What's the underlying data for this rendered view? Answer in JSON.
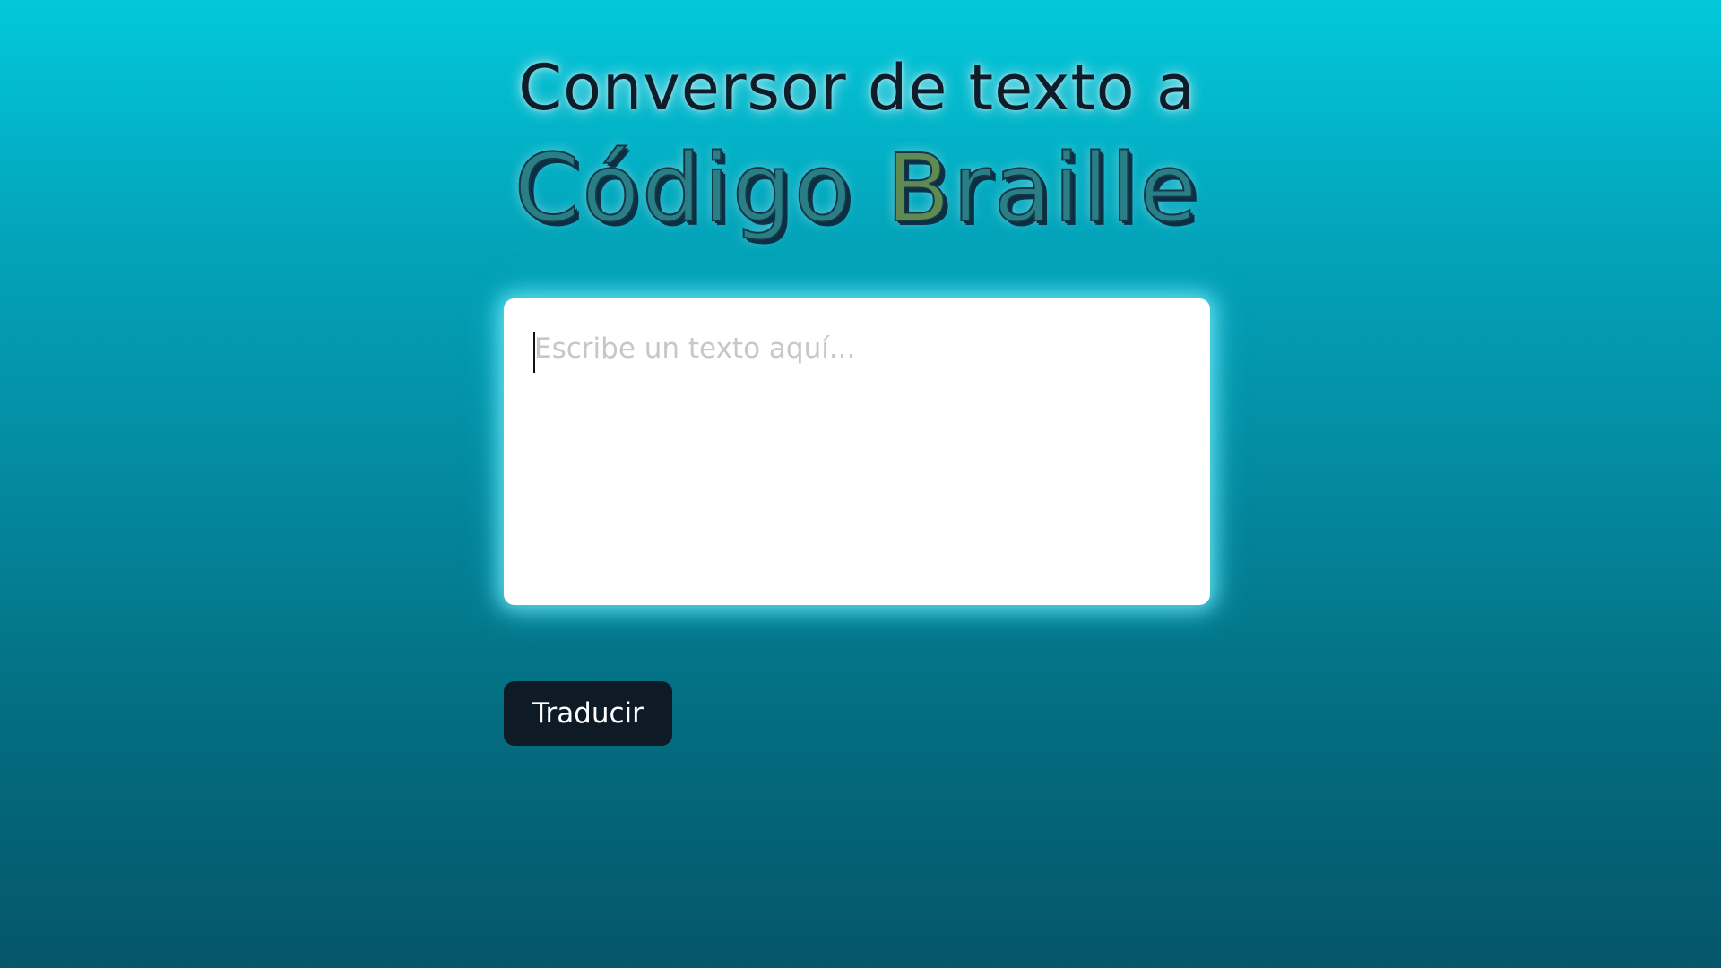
{
  "header": {
    "title_line1": "Conversor de texto a",
    "title_line2_part1": "Código ",
    "title_line2_part2": "B",
    "title_line2_part3": "raille"
  },
  "input": {
    "placeholder": "Escribe un texto aquí...",
    "value": ""
  },
  "actions": {
    "translate_label": "Traducir"
  },
  "colors": {
    "background_top": "#03c8db",
    "background_bottom": "#05566a",
    "title_dark": "#0f1c2a",
    "button_bg": "#0e1b26",
    "button_text": "#ffffff",
    "input_glow": "#78f0ff"
  }
}
